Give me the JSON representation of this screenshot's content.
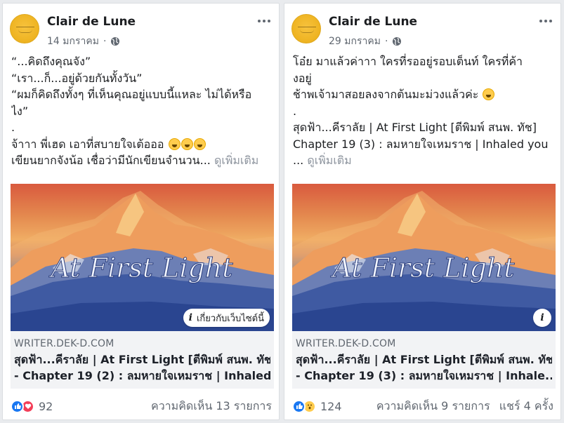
{
  "left": {
    "page_name": "Clair de Lune",
    "date": "14 มกราคม",
    "text_lines": [
      "“...คิดถึงคุณจัง”",
      "“เรา...ก็...อยู่ด้วยกันทั้งวัน”",
      "“ผมก็คิดถึงทั้งๆ ที่เห็นคุณอยู่แบบนี้แหละ ไม่ได้หรือ",
      "ไง”",
      ".",
      "จ้าาา พี่เฮด เอาที่สบายใจเต้อออ",
      "เขียนยากจังน้อ เชื่อว่ามีนักเขียนจำนวน..."
    ],
    "see_more": "ดูเพิ่มเติม",
    "image_caption": "At First Light",
    "about_button": "เกี่ยวกับเว็บไซต์นี้",
    "domain": "WRITER.DEK-D.COM",
    "link_title_1": "สุดฟ้า...คีราลัย | At First Light [ตีพิมพ์ สนพ. ทัช]",
    "link_title_2": "- Chapter 19 (2) : ลมหายใจเหมราช | Inhaled...",
    "reaction_count": "92",
    "comments": "ความคิดเห็น 13 รายการ",
    "icons": {
      "avatar": "clair-de-lune-logo",
      "globe": "globe-icon",
      "more": "more-icon",
      "emoji": "tears-of-joy-emoji",
      "like": "like-reaction-icon",
      "love": "love-reaction-icon"
    }
  },
  "right": {
    "page_name": "Clair de Lune",
    "date": "29 มกราคม",
    "text_lines": [
      "โอ๋ย มาแล้วค่าาา ใครที่รออยู่รอบเต็นท์ ใครที่ค้า",
      "งอยู่",
      "ช้าพเจ้ามาสอยลงจากต้นมะม่วงแล้วค่ะ",
      ".",
      "สุดฟ้า...คีราลัย | At First Light [ตีพิมพ์ สนพ. ทัช]",
      "Chapter 19 (3) : ลมหายใจเหมราช | Inhaled you",
      "..."
    ],
    "see_more": "ดูเพิ่มเติม",
    "image_caption": "At First Light",
    "domain": "WRITER.DEK-D.COM",
    "link_title_1": "สุดฟ้า...คีราลัย | At First Light [ตีพิมพ์ สนพ. ทัช]",
    "link_title_2": "- Chapter 19 (3) : ลมหายใจเหมราช | Inhale...",
    "reaction_count": "124",
    "comments": "ความคิดเห็น 9 รายการ",
    "shares": "แชร์ 4 ครั้ง",
    "icons": {
      "avatar": "clair-de-lune-logo",
      "globe": "globe-icon",
      "more": "more-icon",
      "emoji": "tears-of-joy-emoji",
      "like": "like-reaction-icon",
      "wow": "wow-reaction-icon"
    }
  }
}
